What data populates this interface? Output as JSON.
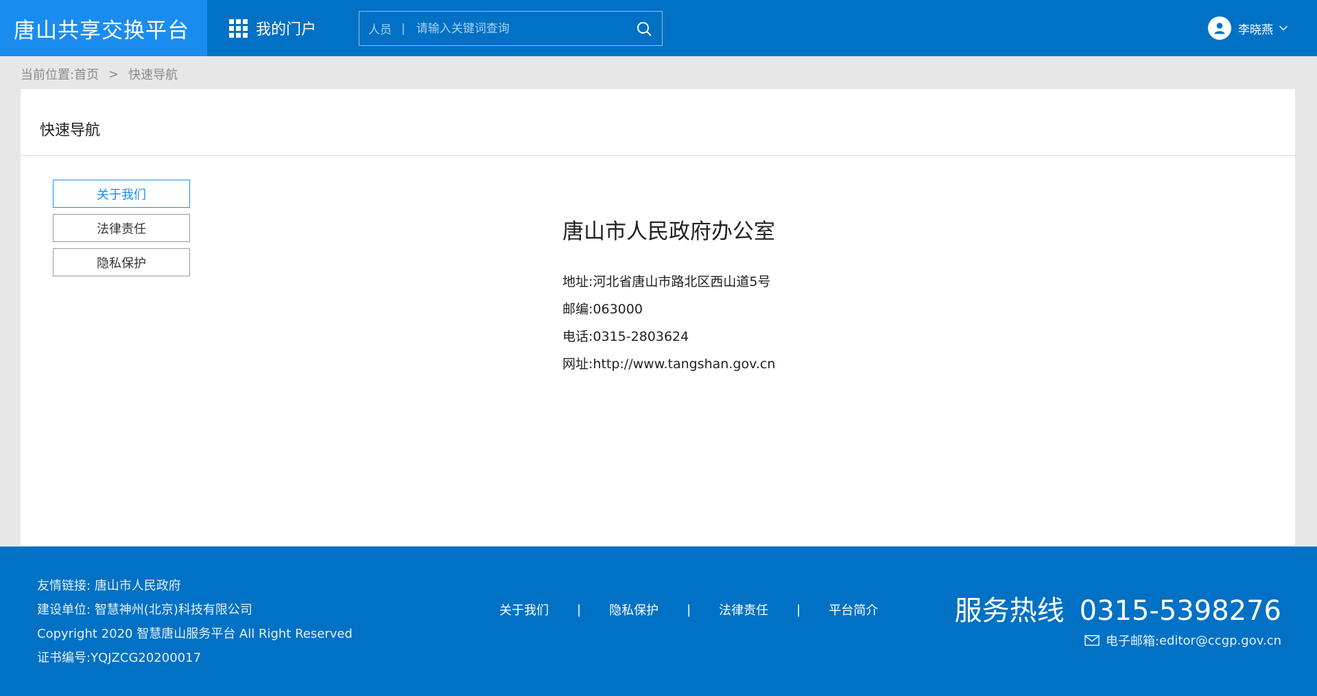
{
  "header": {
    "logo": "唐山共享交换平台",
    "portal_label": "我的门户",
    "search": {
      "category": "人员",
      "separator": "|",
      "placeholder": "请输入关键词查询"
    },
    "user_name": "李晓燕"
  },
  "breadcrumb": {
    "prefix": "当前位置:",
    "home": "首页",
    "separator": ">",
    "current": "快速导航"
  },
  "panel": {
    "title": "快速导航",
    "side_nav": [
      {
        "label": "关于我们",
        "active": true
      },
      {
        "label": "法律责任",
        "active": false
      },
      {
        "label": "隐私保护",
        "active": false
      }
    ],
    "org": {
      "name": "唐山市人民政府办公室",
      "rows": [
        {
          "label": "地址:",
          "value": "河北省唐山市路北区西山道5号"
        },
        {
          "label": "邮编:",
          "value": "063000"
        },
        {
          "label": "电话:",
          "value": "0315-2803624"
        },
        {
          "label": "网址:",
          "value": "http://www.tangshan.gov.cn"
        }
      ]
    }
  },
  "footer": {
    "friend_links_label": "友情链接:",
    "friend_link": "唐山市人民政府",
    "builder_label": "建设单位:",
    "builder": "智慧神州(北京)科技有限公司",
    "copyright": "Copyright 2020 智慧唐山服务平台 All Right Reserved",
    "cert_label": "证书编号:",
    "cert": "YQJZCG20200017",
    "nav": [
      "关于我们",
      "隐私保护",
      "法律责任",
      "平台简介"
    ],
    "nav_separator": "|",
    "hotline_label": "服务热线",
    "hotline_number": "0315-5398276",
    "email_label": "电子邮箱:",
    "email": "editor@ccgp.gov.cn"
  },
  "colors": {
    "header_bg": "#0071c5",
    "logo_bg": "#1a8cf0",
    "accent": "#1a8cf0",
    "page_bg": "#e7e7e7"
  },
  "icons": {
    "apps": "grid-icon",
    "search": "search-icon",
    "user": "user-icon",
    "dropdown": "chevron-down-icon",
    "email": "mail-icon"
  }
}
